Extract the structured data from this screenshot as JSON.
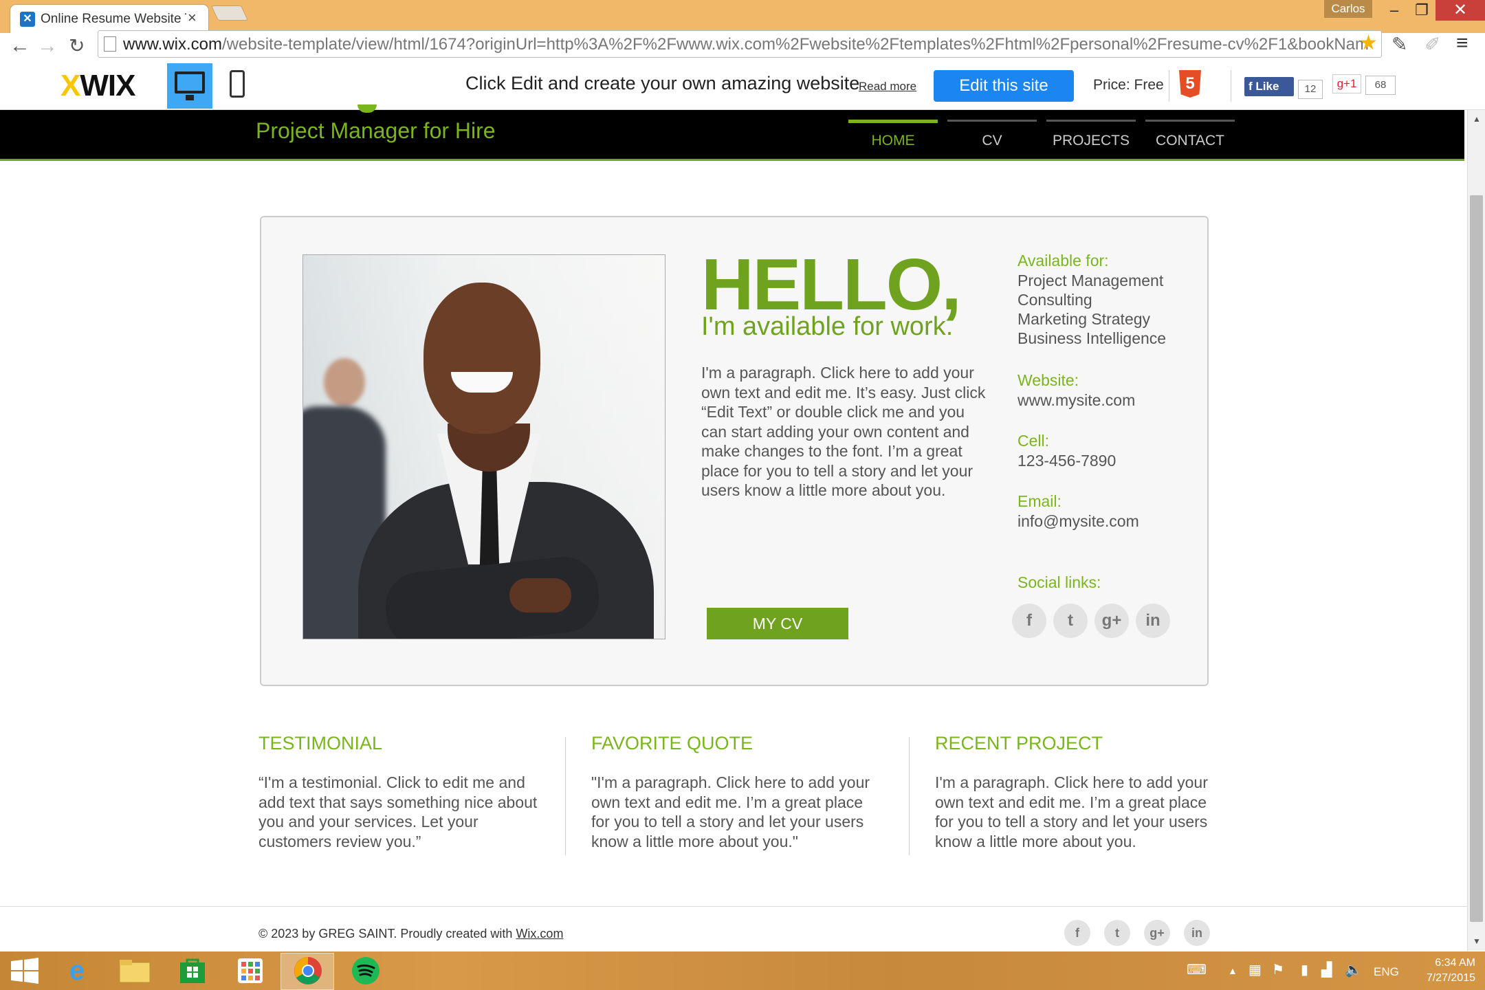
{
  "browser": {
    "tab_title": "Online Resume Website T",
    "tab_close": "×",
    "user_name": "Carlos",
    "url_host": "www.wix.com",
    "url_path": "/website-template/view/html/1674?originUrl=http%3A%2F%2Fwww.wix.com%2Fwebsite%2Ftemplates%2Fhtml%2Fpersonal%2Fresume-cv%2F1&bookNam",
    "back_icon": "arrow-left-icon",
    "forward_icon": "arrow-right-icon",
    "reload_icon": "reload-icon"
  },
  "wixbar": {
    "logo_x": "X",
    "logo_text": "WIX",
    "promo_text": "Click Edit and create your own amazing website",
    "read_more": "Read more",
    "edit_button": "Edit this site",
    "price": "Price: Free",
    "html5": "5",
    "fb_like": "Like",
    "fb_count": "12",
    "gplus_label": "g+1",
    "gplus_count": "68"
  },
  "site": {
    "tagline": "Project Manager for Hire",
    "nav": [
      "HOME",
      "CV",
      "PROJECTS",
      "CONTACT"
    ],
    "active_nav": "HOME",
    "accent_color": "#6fa31f"
  },
  "hero": {
    "heading": "HELLO,",
    "subheading": "I'm available for work.",
    "intro": "I'm a paragraph. Click here to add your own text and edit me. It’s easy. Just click “Edit Text” or double click me and you can start adding your own content and make changes to the font. I’m a great place for you to tell a story and let your users know a little more about you.",
    "cv_button": "MY CV",
    "available_label": "Available for:",
    "available_items": [
      "Project Management",
      "Consulting",
      "Marketing Strategy",
      "Business Intelligence"
    ],
    "website_label": "Website:",
    "website_value": "www.mysite.com",
    "cell_label": "Cell:",
    "cell_value": "123-456-7890",
    "email_label": "Email:",
    "email_value": "info@mysite.com",
    "social_label": "Social links:",
    "social_icons": [
      "f",
      "t",
      "g+",
      "in"
    ]
  },
  "columns": [
    {
      "title": "TESTIMONIAL",
      "text": "“I'm a testimonial. Click to edit me and add text that says something nice about you and your services. Let your customers review you.”"
    },
    {
      "title": "FAVORITE QUOTE",
      "text": "\"I'm a paragraph. Click here to add your own text and edit me. I’m a great place for you to tell a story and let your users know a little more about you.\""
    },
    {
      "title": "RECENT PROJECT",
      "text": "I'm a paragraph. Click here to add your own text and edit me. I’m a great place for you to tell a story and let your users know a little more about you."
    }
  ],
  "footer": {
    "copyright": "© 2023 by GREG SAINT. Proudly created with ",
    "link": "Wix.com"
  },
  "taskbar": {
    "language": "ENG",
    "time": "6:34 AM",
    "date": "7/27/2015"
  }
}
